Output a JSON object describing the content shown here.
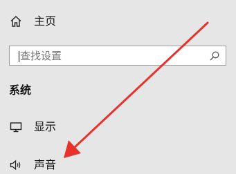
{
  "nav": {
    "home": {
      "label": "主页",
      "icon": "home-icon"
    },
    "search": {
      "placeholder": "查找设置",
      "value": "",
      "icon": "search-icon"
    },
    "section_heading": "系统",
    "items": [
      {
        "label": "显示",
        "icon": "monitor-icon"
      },
      {
        "label": "声音",
        "icon": "speaker-icon"
      }
    ]
  },
  "annotation": {
    "type": "arrow",
    "color": "#e8312b",
    "points_to": "声音"
  },
  "colors": {
    "background": "#e6e6e6",
    "text": "#111111",
    "search_bg": "#ffffff",
    "search_border": "#9a9a9a"
  }
}
